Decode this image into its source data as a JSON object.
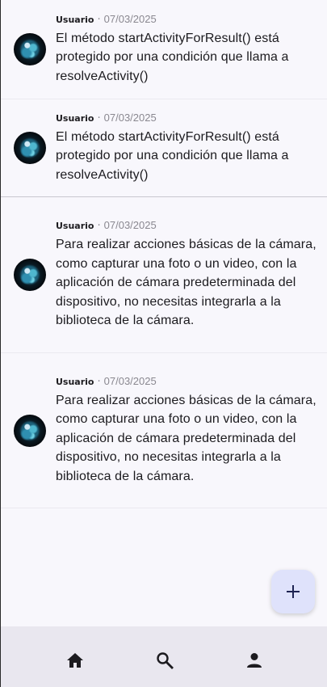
{
  "posts": [
    {
      "author": "Usuario",
      "separator": "·",
      "date": "07/03/2025",
      "text": "El método startActivityForResult() está protegido por una condición que llama a resolveActivity()"
    },
    {
      "author": "Usuario",
      "separator": "·",
      "date": "07/03/2025",
      "text": "El método startActivityForResult() está protegido por una condición que llama a resolveActivity()"
    },
    {
      "author": "Usuario",
      "separator": "·",
      "date": "07/03/2025",
      "text": "Para realizar acciones básicas de la cámara, como capturar una foto o un video, con la aplicación de cámara predeterminada del dispositivo, no necesitas integrarla a la biblioteca de la cámara."
    },
    {
      "author": "Usuario",
      "separator": "·",
      "date": "07/03/2025",
      "text": "Para realizar acciones básicas de la cámara, como capturar una foto o un video, con la aplicación de cámara predeterminada del dispositivo, no necesitas integrarla a la biblioteca de la cámara."
    }
  ],
  "fab": {
    "icon": "add-icon"
  },
  "bottom_nav": {
    "items": [
      {
        "icon": "home-icon"
      },
      {
        "icon": "search-icon"
      },
      {
        "icon": "person-icon"
      }
    ]
  },
  "colors": {
    "background": "#f8f7fc",
    "fab_background": "#dfe2fb",
    "nav_background": "#e9e7ef",
    "text": "#1c1b1f",
    "muted": "#8a8890"
  }
}
